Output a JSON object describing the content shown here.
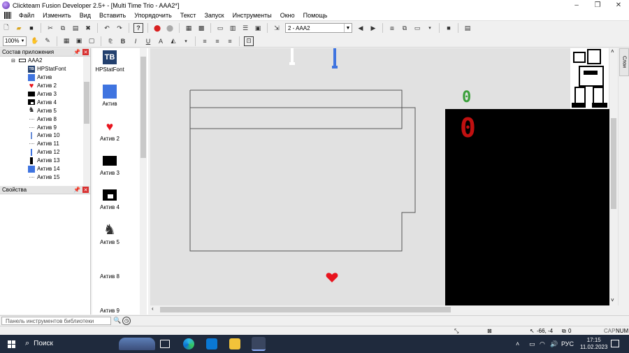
{
  "window": {
    "title": "Clickteam Fusion Developer 2.5+ - [Multi Time Trio - AAA2*]",
    "controls": [
      "–",
      "❐",
      "✕"
    ]
  },
  "menu": [
    "Файл",
    "Изменить",
    "Вид",
    "Вставить",
    "Упорядочить",
    "Текст",
    "Запуск",
    "Инструменты",
    "Окно",
    "Помощь"
  ],
  "toolbar": {
    "frame_select": "2 - AAA2",
    "zoom": "100%"
  },
  "workspace_panel": {
    "title": "Состав приложения",
    "root": "AAA2",
    "items": [
      {
        "label": "HPStatFont",
        "icon": "tb-font-icon"
      },
      {
        "label": "Актив",
        "icon": "blue-square-icon"
      },
      {
        "label": "Актив 2",
        "icon": "heart-icon"
      },
      {
        "label": "Актив 3",
        "icon": "black-rect-icon"
      },
      {
        "label": "Актив 4",
        "icon": "box-icon"
      },
      {
        "label": "Актив 5",
        "icon": "sprite-icon"
      },
      {
        "label": "Актив 8",
        "icon": "dash-icon"
      },
      {
        "label": "Актив 9",
        "icon": "dash-icon"
      },
      {
        "label": "Актив 10",
        "icon": "bone-icon"
      },
      {
        "label": "Актив 11",
        "icon": "dash-icon"
      },
      {
        "label": "Актив 12",
        "icon": "blue-bar-icon"
      },
      {
        "label": "Актив 13",
        "icon": "black-bar-icon"
      },
      {
        "label": "Актив 14",
        "icon": "blue-square-icon"
      },
      {
        "label": "Актив 15",
        "icon": "dash-icon"
      }
    ]
  },
  "properties_panel": {
    "title": "Свойства"
  },
  "object_library": [
    {
      "label": "HPStatFont"
    },
    {
      "label": "Актив"
    },
    {
      "label": "Актив 2"
    },
    {
      "label": "Актив 3"
    },
    {
      "label": "Актив 4"
    },
    {
      "label": "Актив 5"
    },
    {
      "label": "Актив 8"
    },
    {
      "label": "Актив 9"
    }
  ],
  "editor": {
    "score_small": "0",
    "score_large": "0",
    "side_tab": "Слои"
  },
  "library_bar": {
    "placeholder": "Панель инструментов библиотеки"
  },
  "status": {
    "coords": "-66, -4",
    "count": "0",
    "caps": "CAP",
    "num": "NUM"
  },
  "taskbar": {
    "search": "Поиск",
    "lang": "РУС",
    "time": "17:15",
    "date": "11.02.2023"
  },
  "colors": {
    "heart": "#e8141e",
    "blue": "#3f74e0",
    "score_green": "#3aa03a",
    "score_red": "#c01010"
  }
}
